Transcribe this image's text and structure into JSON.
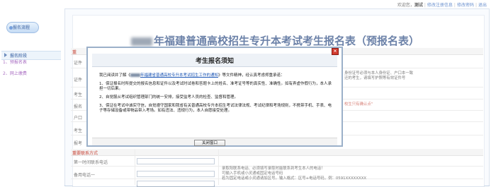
{
  "topbar": {
    "welcome": "欢迎您，",
    "username": "测试",
    "link1": "修改注册信息",
    "link2": "修改密码",
    "link3": "退出"
  },
  "sidebar": {
    "logo_text": "报名流程",
    "section_label": "报名阶段",
    "items": [
      {
        "label": "1、预报名表"
      },
      {
        "label": "2、网上缴费"
      }
    ]
  },
  "main": {
    "title_year_blurred": true,
    "title": "年福建普通高校招生专升本考试考生报名表（预报名表）",
    "section1_label": "重",
    "row_labels": [
      "证件",
      "证件",
      "考生",
      "报名",
      "户口",
      "考生",
      "报考"
    ],
    "section2_label": "重要联系方式",
    "contact_rows": [
      "第一时间联系电话",
      "备用电话一",
      ""
    ],
    "right_notes": {
      "id_note_1": "身份证号必须与本人身份证、户口本一致",
      "id_note_2": "迁的考生，请填写护照等有效证件号",
      "red_note": "校生只有确认点\"",
      "contact_note_1": "录取阳联系电话、必须填写录取时能联系到考生本人的电话！",
      "contact_note_2": "可输入手机或小灵通或固定电话号码",
      "contact_note_3": "若为固定电话或小灵通请加区号。输入格式：区号+电话号码，例：0591XXXXXXXX"
    }
  },
  "modal": {
    "title": "考生报名须知",
    "close_x": "×",
    "para1_prefix": "我已阅读并了解《",
    "para1_link": "年福建省普通高校专升本考试招生工作的通知",
    "para1_suffix": "》等文件精神，经认真考虑郑重承诺：",
    "para2": "1、保证报名时所提交的报名信息和证件以及考试时试卷和答题卡上的姓名、准考证号等的真实性、准确性。如有弄虚作假行为，本人承担一切后果。",
    "para3": "2、自觉服从考试组织管理部门的统一安排，接受监考人员的检查、监督和管理。",
    "para4": "3、保证在考试中诚实守信，自觉遵守国家和我省有关普通高校专升本招生考试法律法规、考试纪律和考场规则，不携带手机、手表、电子等存储设备或带物品带入考场。如有违法、违规行为，本人自愿接受处理。",
    "close_button": "关闭窗口"
  }
}
